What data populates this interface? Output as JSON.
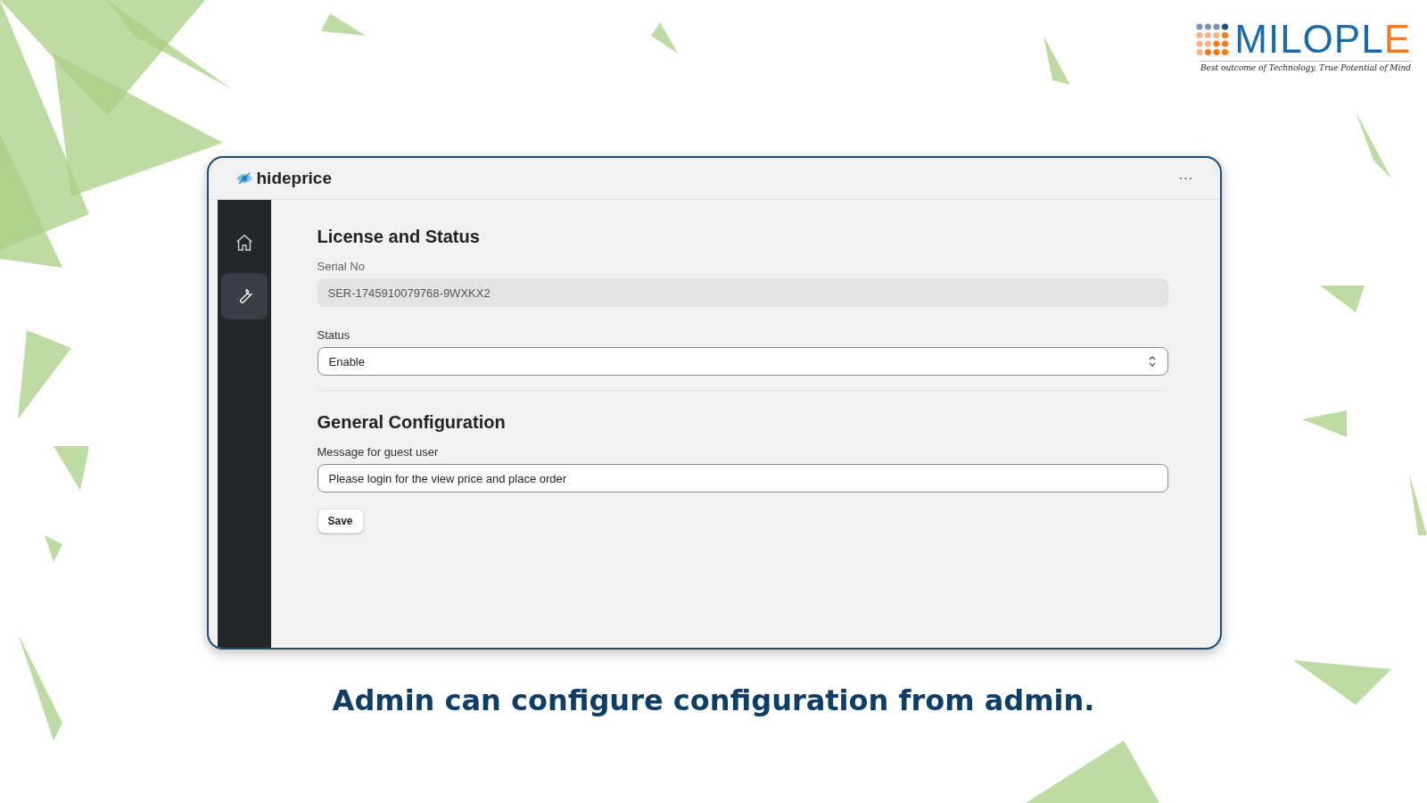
{
  "brand": {
    "name": "MILOPLE",
    "tagline": "Best outcome of Technology, True Potential of Mind"
  },
  "window": {
    "title": "hideprice",
    "menu": "···"
  },
  "sidebar": {
    "items": [
      {
        "kind": "home",
        "selected": false
      },
      {
        "kind": "wrench",
        "selected": true
      }
    ]
  },
  "license": {
    "heading": "License and Status",
    "serial_label": "Serial No",
    "serial_value": "SER-1745910079768-9WXKX2",
    "status_label": "Status",
    "status_value": "Enable"
  },
  "general": {
    "heading": "General Configuration",
    "message_label": "Message for guest user",
    "message_value": "Please login for the view price and place order",
    "save": "Save"
  },
  "caption": "Admin can configure configuration from admin."
}
